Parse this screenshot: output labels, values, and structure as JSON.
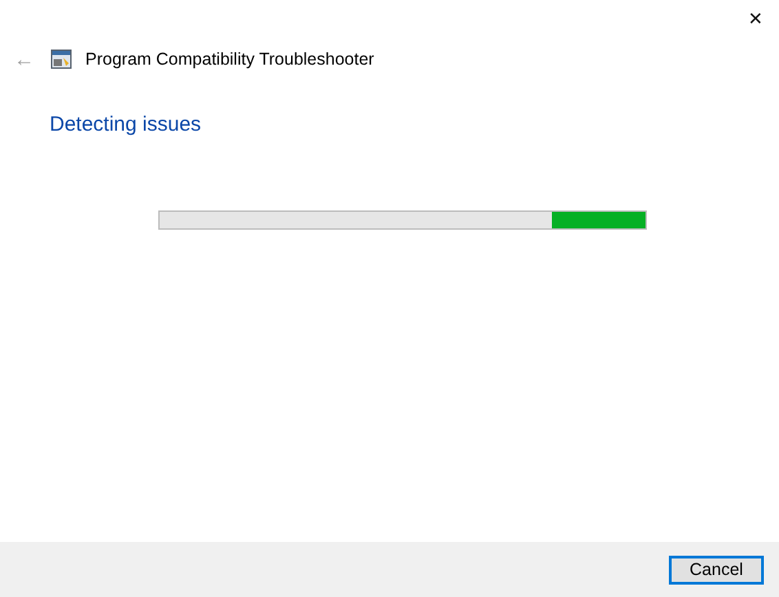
{
  "window": {
    "close": "✕"
  },
  "header": {
    "back": "←",
    "title": "Program Compatibility Troubleshooter"
  },
  "heading": "Detecting issues",
  "progress": {
    "kind": "marquee",
    "level": 0.19
  },
  "buttons": [
    {
      "label": "Cancel",
      "default": true
    }
  ]
}
